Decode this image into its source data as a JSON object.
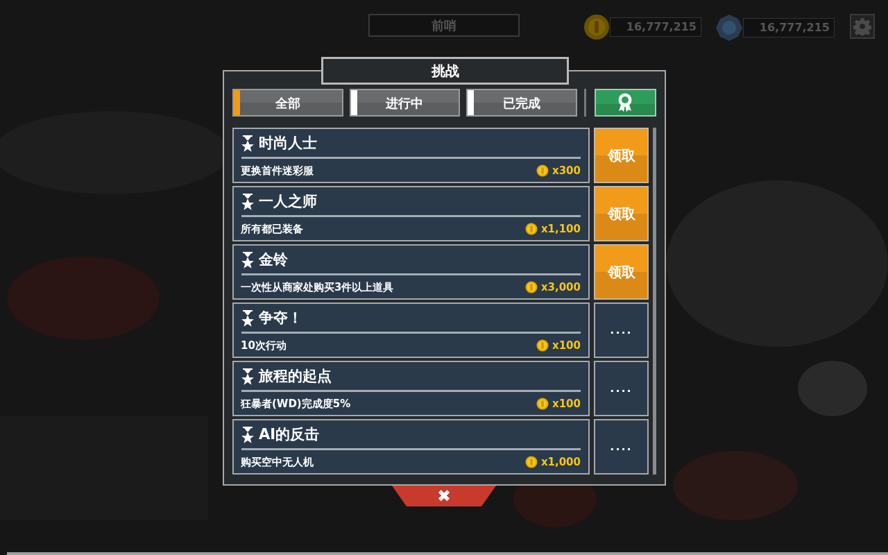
{
  "hud": {
    "location": "前哨",
    "currencies": [
      {
        "kind": "coin",
        "value": "16,777,215"
      },
      {
        "kind": "gem",
        "value": "16,777,215"
      }
    ]
  },
  "dialog": {
    "title": "挑战",
    "tabs": [
      {
        "label": "全部",
        "selected": true
      },
      {
        "label": "进行中",
        "selected": false
      },
      {
        "label": "已完成",
        "selected": false
      }
    ],
    "challenges": [
      {
        "title": "时尚人士",
        "description": "更换首件迷彩服",
        "reward": "x300",
        "action": {
          "kind": "claim",
          "label": "领取"
        }
      },
      {
        "title": "一人之师",
        "description": "所有都已装备",
        "reward": "x1,100",
        "action": {
          "kind": "claim",
          "label": "领取"
        }
      },
      {
        "title": "金铃",
        "description": "一次性从商家处购买3件以上道具",
        "reward": "x3,000",
        "action": {
          "kind": "claim",
          "label": "领取"
        }
      },
      {
        "title": "争夺！",
        "description": "10次行动",
        "reward": "x100",
        "action": {
          "kind": "pending",
          "label": "...."
        }
      },
      {
        "title": "旅程的起点",
        "description": "狂暴者(WD)完成度5%",
        "reward": "x100",
        "action": {
          "kind": "pending",
          "label": "...."
        }
      },
      {
        "title": "AI的反击",
        "description": "购买空中无人机",
        "reward": "x1,000",
        "action": {
          "kind": "pending",
          "label": "...."
        }
      }
    ],
    "close": "✖"
  }
}
